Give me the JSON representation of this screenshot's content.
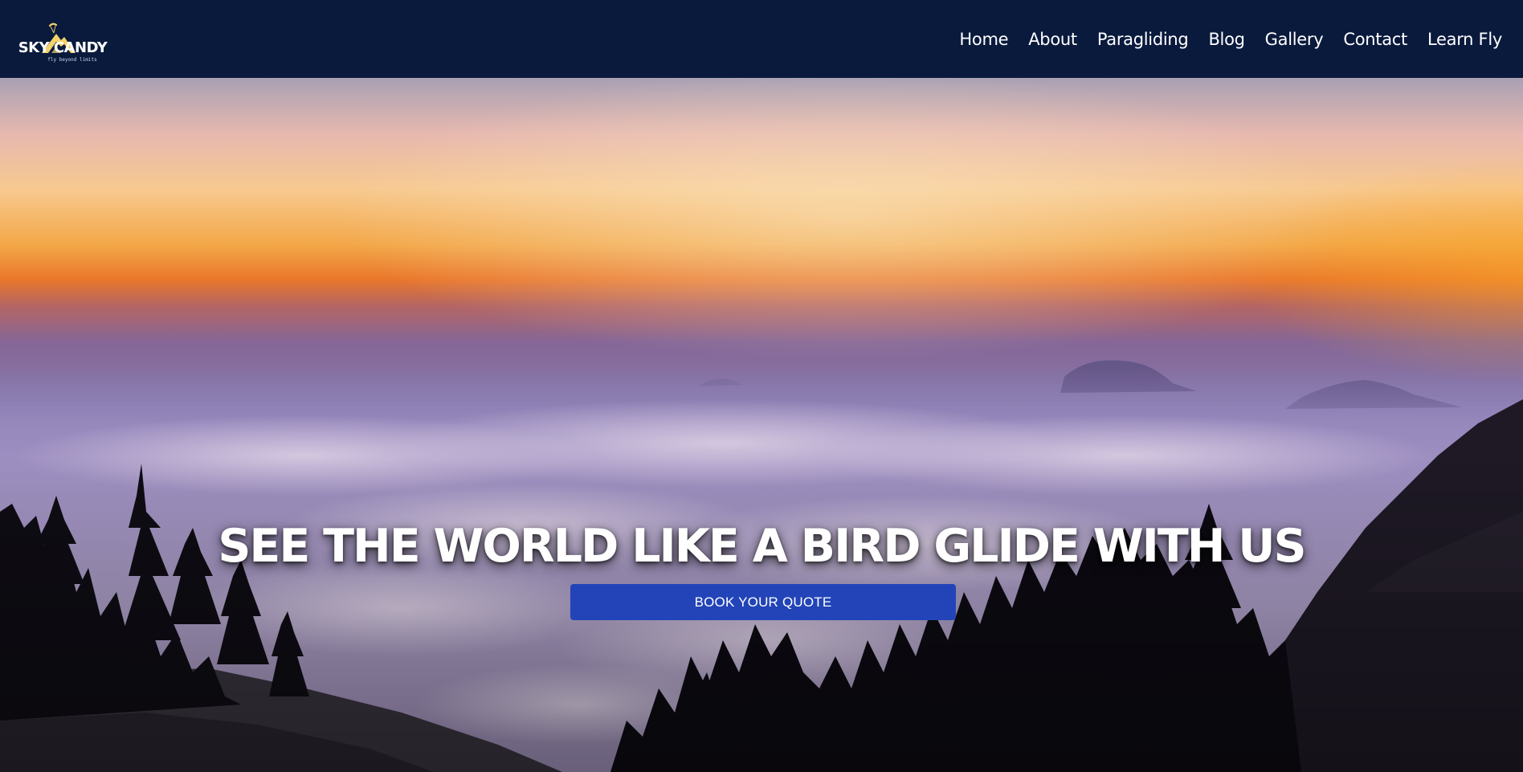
{
  "brand": {
    "name": "SKY CANDY",
    "tagline": "fly beyond limits",
    "icon": "paraglider-mountain-logo"
  },
  "nav": {
    "items": [
      {
        "label": "Home"
      },
      {
        "label": "About"
      },
      {
        "label": "Paragliding"
      },
      {
        "label": "Blog"
      },
      {
        "label": "Gallery"
      },
      {
        "label": "Contact"
      },
      {
        "label": "Learn Fly"
      }
    ]
  },
  "hero": {
    "headline": "SEE THE WORLD LIKE A BIRD GLIDE WITH US",
    "cta_label": "BOOK YOUR QUOTE",
    "background": "sunset-above-clouds-with-forest-silhouette"
  },
  "colors": {
    "navbar": "#0a1a3d",
    "cta": "#2244b8",
    "logo_accent": "#f2d36b"
  }
}
